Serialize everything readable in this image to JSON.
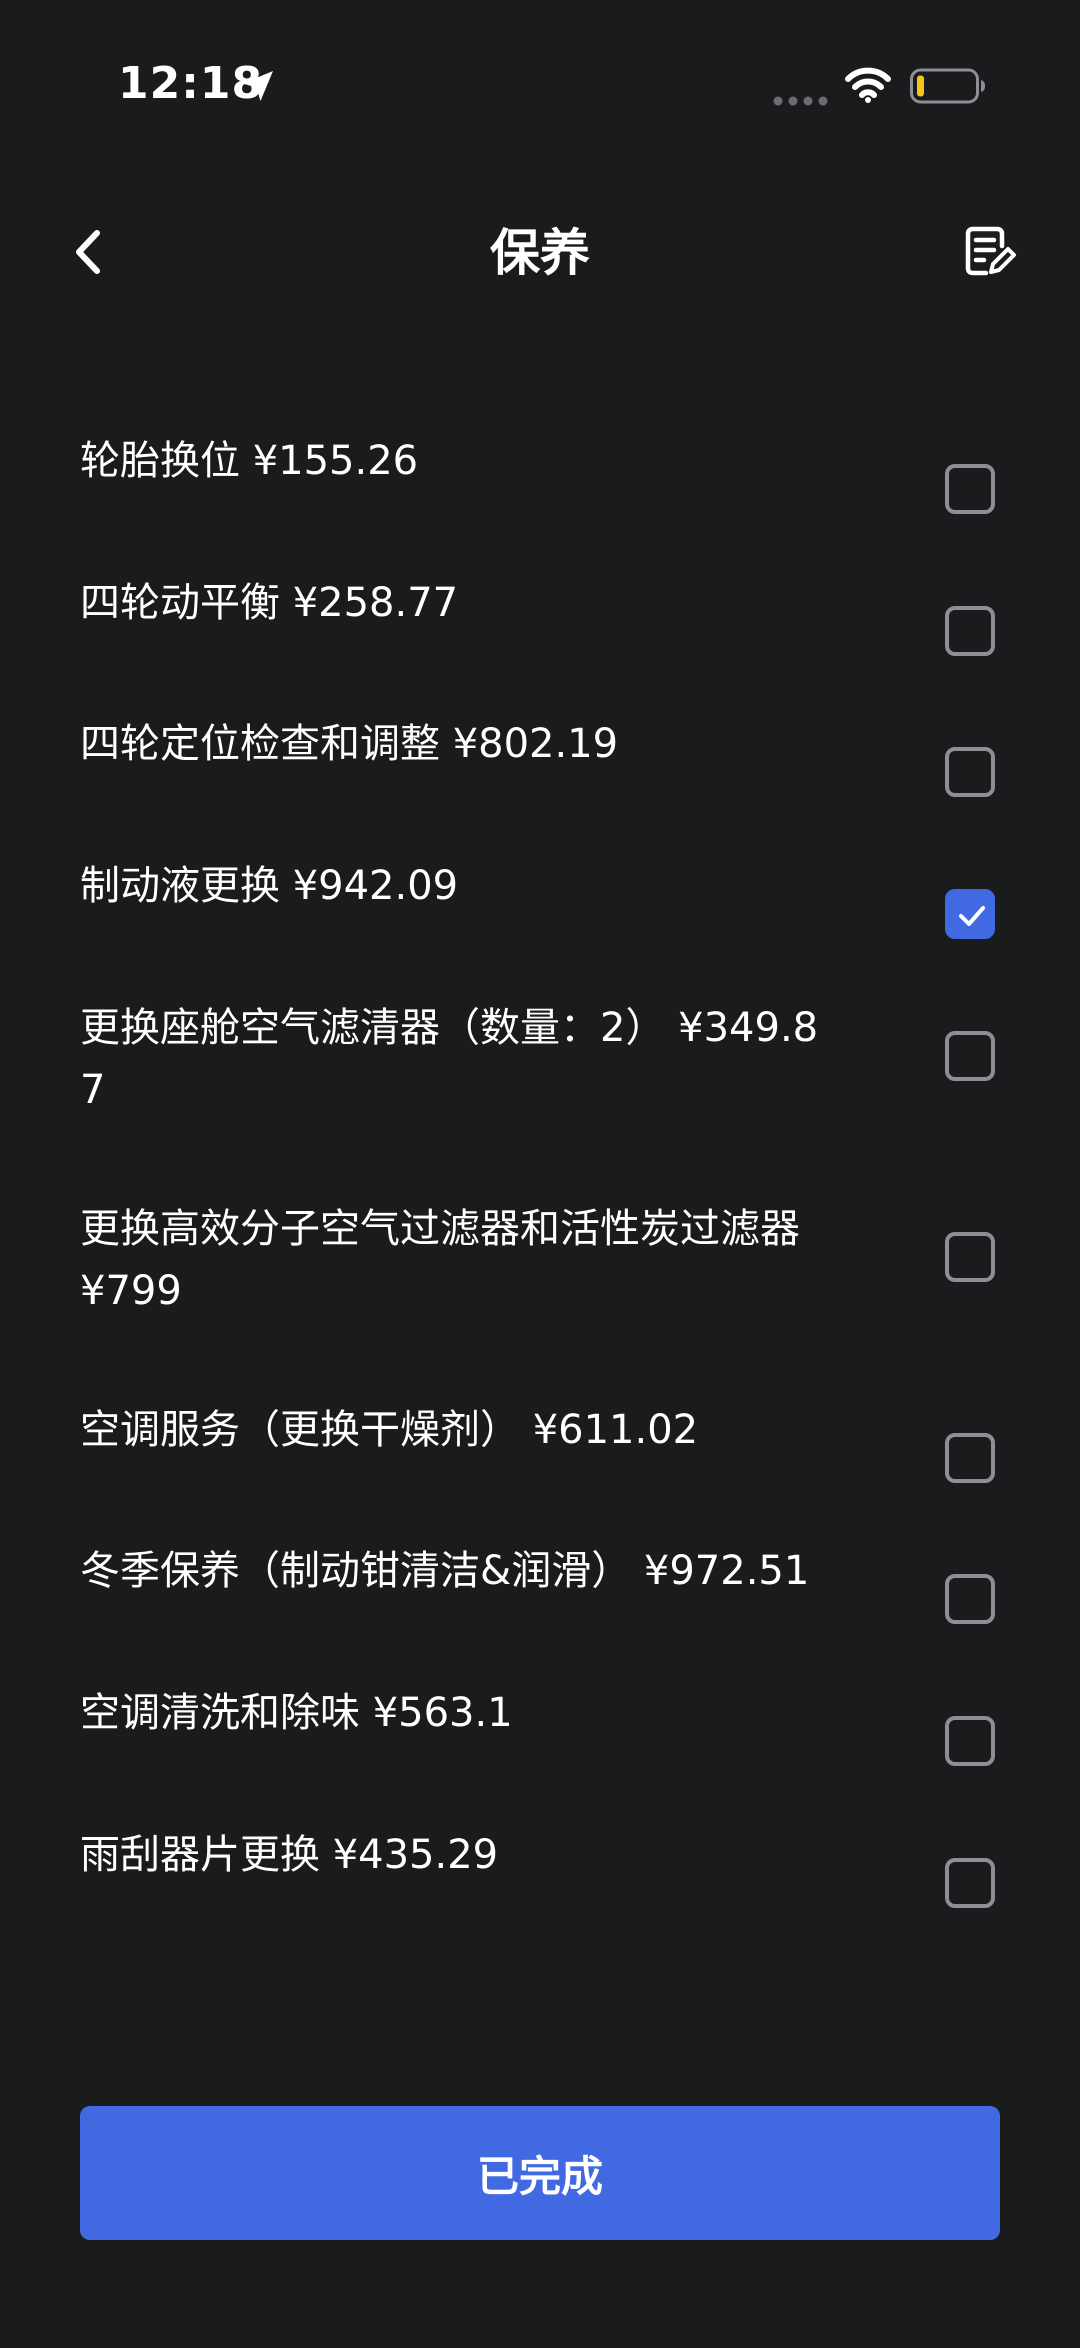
{
  "status_bar": {
    "time": "12:18"
  },
  "header": {
    "title": "保养"
  },
  "items": [
    {
      "label": "轮胎换位 ¥155.26",
      "checked": false
    },
    {
      "label": "四轮动平衡 ¥258.77",
      "checked": false
    },
    {
      "label": "四轮定位检查和调整 ¥802.19",
      "checked": false
    },
    {
      "label": "制动液更换 ¥942.09",
      "checked": true
    },
    {
      "label": "更换座舱空气滤清器（数量：2） ¥349.87",
      "checked": false
    },
    {
      "label": "更换高效分子空气过滤器和活性炭过滤器 ¥799",
      "checked": false
    },
    {
      "label": "空调服务（更换干燥剂） ¥611.02",
      "checked": false
    },
    {
      "label": "冬季保养（制动钳清洁&润滑） ¥972.51",
      "checked": false
    },
    {
      "label": "空调清洗和除味 ¥563.1",
      "checked": false
    },
    {
      "label": "雨刮器片更换 ¥435.29",
      "checked": false
    }
  ],
  "footer": {
    "done_label": "已完成"
  },
  "colors": {
    "background": "#1a1b1d",
    "accent": "#4169e1",
    "checkbox_border": "#8e8f94"
  },
  "icons": {
    "back": "chevron-left-icon",
    "notes": "edit-notes-icon",
    "check": "checkmark-icon",
    "location": "location-arrow-icon",
    "wifi": "wifi-icon",
    "battery": "battery-low-icon"
  }
}
